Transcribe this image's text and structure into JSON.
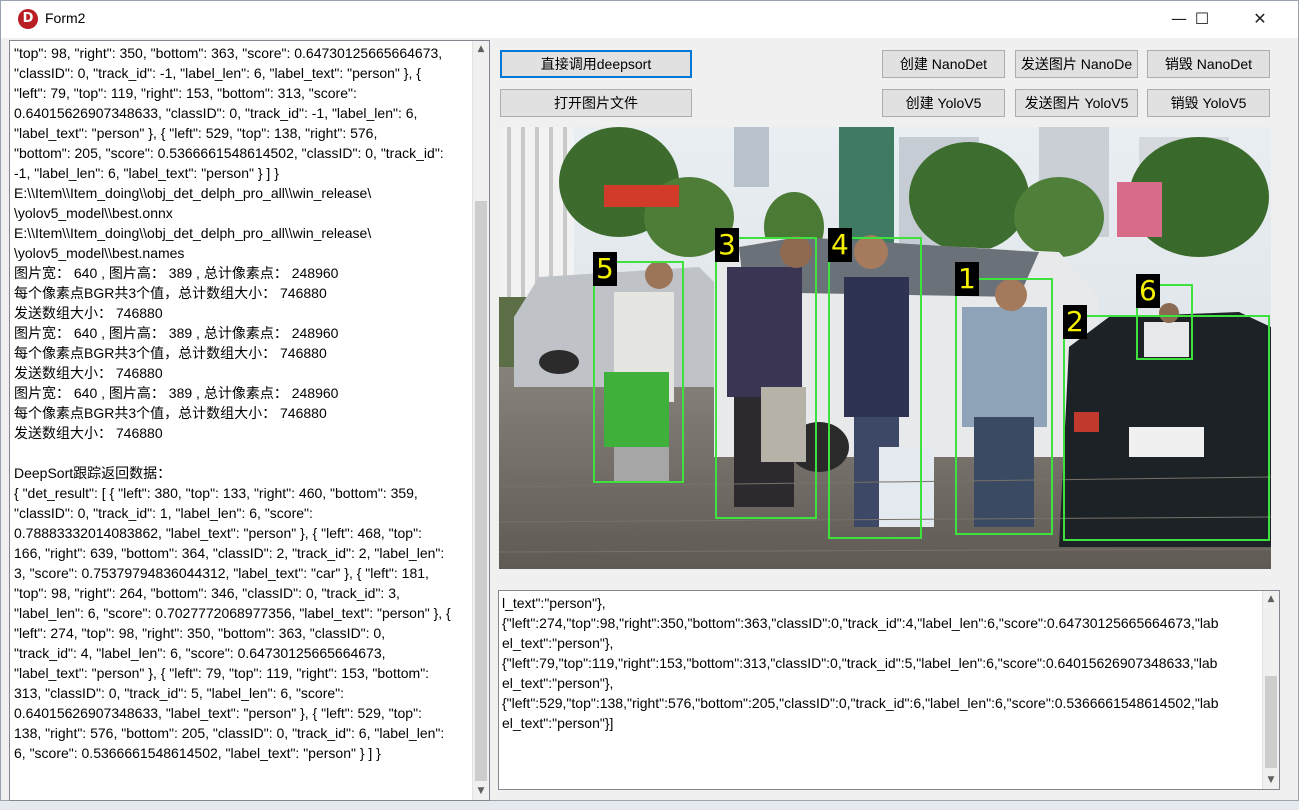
{
  "window": {
    "title": "Form2",
    "app_icon_letter": "D",
    "controls": {
      "minimize": "—",
      "maximize": "☐",
      "close": "✕"
    }
  },
  "buttons": {
    "deepsort": "直接调用deepsort",
    "open_image": "打开图片文件",
    "create_nanodet": "创建 NanoDet",
    "send_nanodet": "发送图片 NanoDe",
    "destroy_nanodet": "销毁 NanoDet",
    "create_yolov5": "创建 YoloV5",
    "send_yolov5": "发送图片 YoloV5",
    "destroy_yolov5": "销毁 YoloV5"
  },
  "log_lines": [
    "\"top\": 98, \"right\": 350, \"bottom\": 363, \"score\": 0.64730125665664673,",
    "\"classID\": 0, \"track_id\": -1, \"label_len\": 6, \"label_text\": \"person\" }, {",
    "\"left\": 79, \"top\": 119, \"right\": 153, \"bottom\": 313, \"score\":",
    "0.64015626907348633, \"classID\": 0, \"track_id\": -1, \"label_len\": 6,",
    "\"label_text\": \"person\" }, { \"left\": 529, \"top\": 138, \"right\": 576,",
    "\"bottom\": 205, \"score\": 0.5366661548614502, \"classID\": 0, \"track_id\":",
    "-1, \"label_len\": 6, \"label_text\": \"person\" } ] }",
    "E:\\\\Item\\\\Item_doing\\\\obj_det_delph_pro_all\\\\win_release\\",
    "\\yolov5_model\\\\best.onnx",
    "E:\\\\Item\\\\Item_doing\\\\obj_det_delph_pro_all\\\\win_release\\",
    "\\yolov5_model\\\\best.names",
    "图片宽： 640 , 图片高： 389 , 总计像素点： 248960",
    "每个像素点BGR共3个值，总计数组大小： 746880",
    "发送数组大小： 746880",
    "图片宽： 640 , 图片高： 389 , 总计像素点： 248960",
    "每个像素点BGR共3个值，总计数组大小： 746880",
    "发送数组大小： 746880",
    "图片宽： 640 , 图片高： 389 , 总计像素点： 248960",
    "每个像素点BGR共3个值，总计数组大小： 746880",
    "发送数组大小： 746880",
    "",
    "DeepSort跟踪返回数据：",
    "{ \"det_result\": [ { \"left\": 380, \"top\": 133, \"right\": 460, \"bottom\": 359,",
    "\"classID\": 0, \"track_id\": 1, \"label_len\": 6, \"score\":",
    "0.78883332014083862, \"label_text\": \"person\" }, { \"left\": 468, \"top\":",
    "166, \"right\": 639, \"bottom\": 364, \"classID\": 2, \"track_id\": 2, \"label_len\":",
    "3, \"score\": 0.75379794836044312, \"label_text\": \"car\" }, { \"left\": 181,",
    "\"top\": 98, \"right\": 264, \"bottom\": 346, \"classID\": 0, \"track_id\": 3,",
    "\"label_len\": 6, \"score\": 0.7027772068977356, \"label_text\": \"person\" }, {",
    "\"left\": 274, \"top\": 98, \"right\": 350, \"bottom\": 363, \"classID\": 0,",
    "\"track_id\": 4, \"label_len\": 6, \"score\": 0.64730125665664673,",
    "\"label_text\": \"person\" }, { \"left\": 79, \"top\": 119, \"right\": 153, \"bottom\":",
    "313, \"classID\": 0, \"track_id\": 5, \"label_len\": 6, \"score\":",
    "0.64015626907348633, \"label_text\": \"person\" }, { \"left\": 529, \"top\":",
    "138, \"right\": 576, \"bottom\": 205, \"classID\": 0, \"track_id\": 6, \"label_len\":",
    "6, \"score\": 0.5366661548614502, \"label_text\": \"person\" } ] }"
  ],
  "result_lines": [
    "l_text\":\"person\"},",
    "{\"left\":274,\"top\":98,\"right\":350,\"bottom\":363,\"classID\":0,\"track_id\":4,\"label_len\":6,\"score\":0.64730125665664673,\"lab",
    "el_text\":\"person\"},",
    "{\"left\":79,\"top\":119,\"right\":153,\"bottom\":313,\"classID\":0,\"track_id\":5,\"label_len\":6,\"score\":0.64015626907348633,\"lab",
    "el_text\":\"person\"},",
    "{\"left\":529,\"top\":138,\"right\":576,\"bottom\":205,\"classID\":0,\"track_id\":6,\"label_len\":6,\"score\":0.5366661548614502,\"lab",
    "el_text\":\"person\"}]"
  ],
  "detections": [
    {
      "label": "1"
    },
    {
      "label": "2"
    },
    {
      "label": "3"
    },
    {
      "label": "4"
    },
    {
      "label": "5"
    },
    {
      "label": "6"
    }
  ],
  "scroll": {
    "up_arrow": "▲",
    "down_arrow": "▼"
  },
  "colors": {
    "box": "#3ee13e",
    "label_text": "#f5f000",
    "focus": "#0078d7"
  }
}
